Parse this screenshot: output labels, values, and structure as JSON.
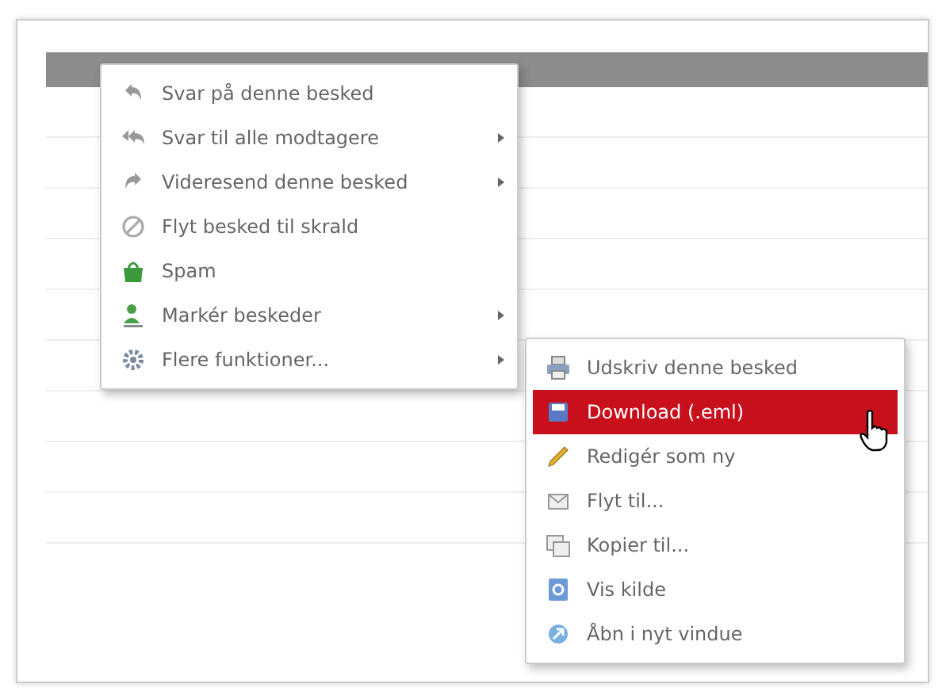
{
  "context_menu": {
    "items": [
      {
        "label": "Svar på denne besked",
        "has_submenu": false,
        "selected": false
      },
      {
        "label": "Svar til alle modtagere",
        "has_submenu": true,
        "selected": false
      },
      {
        "label": "Videresend denne besked",
        "has_submenu": true,
        "selected": false
      },
      {
        "label": "Flyt besked til skrald",
        "has_submenu": false,
        "selected": false
      },
      {
        "label": "Spam",
        "has_submenu": false,
        "selected": false
      },
      {
        "label": "Markér beskeder",
        "has_submenu": true,
        "selected": false
      },
      {
        "label": "Flere funktioner...",
        "has_submenu": true,
        "selected": false
      }
    ]
  },
  "submenu": {
    "items": [
      {
        "label": "Udskriv denne besked",
        "selected": false
      },
      {
        "label": "Download (.eml)",
        "selected": true
      },
      {
        "label": "Redigér som ny",
        "selected": false
      },
      {
        "label": "Flyt til...",
        "selected": false
      },
      {
        "label": "Kopier til...",
        "selected": false
      },
      {
        "label": "Vis kilde",
        "selected": false
      },
      {
        "label": "Åbn i nyt vindue",
        "selected": false
      }
    ]
  }
}
